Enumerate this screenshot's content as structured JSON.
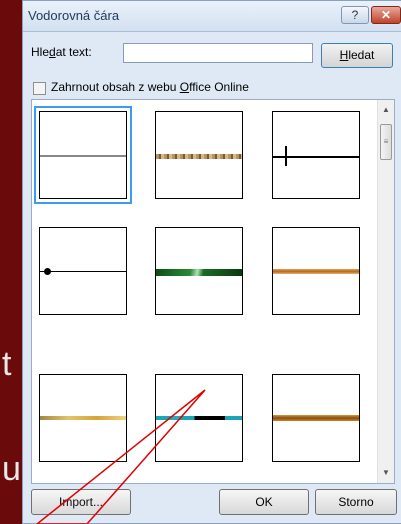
{
  "background": {
    "fragments": [
      "t",
      "u"
    ]
  },
  "dialog": {
    "title": "Vodorovná čára",
    "help_label": "?",
    "close_label": "✕",
    "search": {
      "label": "Hledat text:",
      "value": "",
      "button": "Hledat"
    },
    "checkbox_label": "Zahrnout obsah z webu Office Online",
    "checked": false,
    "gallery": {
      "items": [
        {
          "name": "thin-gray-line",
          "selected": true
        },
        {
          "name": "brown-speckle-line",
          "selected": false
        },
        {
          "name": "black-line-with-cross",
          "selected": false
        },
        {
          "name": "black-line-with-dot",
          "selected": false
        },
        {
          "name": "green-marble-line",
          "selected": false
        },
        {
          "name": "orange-bronze-line",
          "selected": false
        },
        {
          "name": "gold-line",
          "selected": false
        },
        {
          "name": "teal-black-line",
          "selected": false
        },
        {
          "name": "brown-bronze-line",
          "selected": false
        }
      ]
    },
    "buttons": {
      "import": "Import...",
      "ok": "OK",
      "cancel": "Storno"
    }
  },
  "colors": {
    "accent": "#3b9cf2",
    "background": "#6b0a0a",
    "callout": "#e00000"
  }
}
